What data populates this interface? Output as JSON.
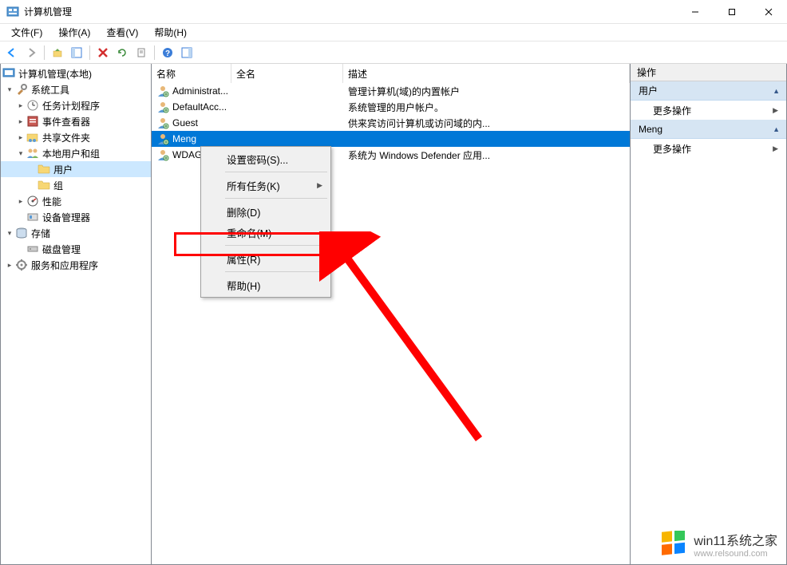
{
  "window": {
    "title": "计算机管理",
    "minimize_label": "—",
    "maximize_label": "□",
    "close_label": "✕"
  },
  "menu": {
    "file": "文件(F)",
    "action": "操作(A)",
    "view": "查看(V)",
    "help": "帮助(H)"
  },
  "tree": {
    "root": "计算机管理(本地)",
    "system_tools": "系统工具",
    "task_scheduler": "任务计划程序",
    "event_viewer": "事件查看器",
    "shared_folders": "共享文件夹",
    "local_users_groups": "本地用户和组",
    "users": "用户",
    "groups": "组",
    "performance": "性能",
    "device_manager": "设备管理器",
    "storage": "存储",
    "disk_management": "磁盘管理",
    "services_apps": "服务和应用程序"
  },
  "list": {
    "headers": {
      "name": "名称",
      "fullname": "全名",
      "description": "描述"
    },
    "col_widths": {
      "name": 100,
      "fullname": 140,
      "description": 210
    },
    "rows": [
      {
        "name": "Administrat...",
        "fullname": "",
        "description": "管理计算机(域)的内置帐户"
      },
      {
        "name": "DefaultAcc...",
        "fullname": "",
        "description": "系统管理的用户帐户。"
      },
      {
        "name": "Guest",
        "fullname": "",
        "description": "供来宾访问计算机或访问域的内..."
      },
      {
        "name": "Meng",
        "fullname": "",
        "description": ""
      },
      {
        "name": "WDAG...",
        "fullname": "",
        "description": "系统为 Windows Defender 应用..."
      }
    ],
    "selected_index": 3
  },
  "context_menu": {
    "set_password": "设置密码(S)...",
    "all_tasks": "所有任务(K)",
    "delete": "删除(D)",
    "rename": "重命名(M)",
    "properties": "属性(R)",
    "help": "帮助(H)"
  },
  "actions_pane": {
    "header": "操作",
    "group1": "用户",
    "more_actions": "更多操作",
    "group2": "Meng"
  },
  "watermark": {
    "line1": "win11系统之家",
    "line2": "www.relsound.com"
  }
}
